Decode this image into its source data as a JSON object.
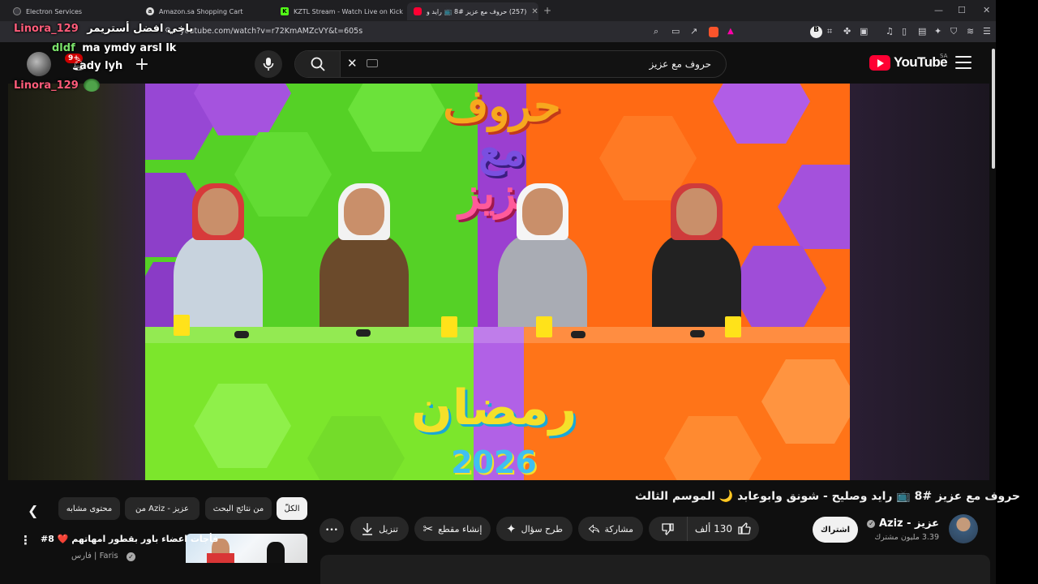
{
  "browser": {
    "tabs": [
      {
        "title": "Electron Services"
      },
      {
        "title": "Amazon.sa Shopping Cart"
      },
      {
        "title": "KZTL Stream - Watch Live on Kick"
      },
      {
        "title": "(257) حروف مع عزيز #8 📺 رايد و"
      }
    ],
    "url": "youtube.com/watch?v=r72KmAMZcVY&t=605s",
    "window_controls": [
      "—",
      "☐",
      "✕"
    ]
  },
  "youtube": {
    "region": "SA",
    "logo_text": "YouTube",
    "search_query": "حروف مع عزيز",
    "notification_count": "9+"
  },
  "chat_overlay": [
    {
      "user": "Linora_129",
      "message": "ياخي افضل أستريمر",
      "user_color": "#ff5c7a"
    },
    {
      "user": "dldf",
      "message": "ma ymdy arsl lk",
      "user_color": "#7be36b"
    },
    {
      "user": "",
      "message": "ady lyh",
      "user_color": "#ffffff"
    },
    {
      "user": "Linora_129",
      "message": "",
      "user_color": "#ff5c7a"
    }
  ],
  "video": {
    "title": "حروف مع عزيز #8 📺 رايد وصليح - شونق وابوعابد 🌙 الموسم الثالث",
    "channel_name": "عزيز - Aziz",
    "subscribers": "3.39 مليون مشترك",
    "subscribe_label": "اشتراك",
    "likes": "130 ألف",
    "share_label": "مشاركة",
    "ask_label": "طرح سؤال",
    "clip_label": "إنشاء مقطع",
    "download_label": "تنزيل",
    "more_label": "•••"
  },
  "filter_chips": [
    {
      "label": "الكلّ",
      "selected": true
    },
    {
      "label": "من نتائج البحث",
      "selected": false
    },
    {
      "label": "من Aziz - عزيز",
      "selected": false
    },
    {
      "label": "محتوى مشابه",
      "selected": false
    }
  ],
  "recommendation": {
    "title": "#8 ❤️ فأجات اعضاء باور بقطور امهاتهم",
    "channel": "فارس | Faris"
  },
  "colors": {
    "accent": "#ff0033",
    "page_bg": "#0f0f0f"
  }
}
